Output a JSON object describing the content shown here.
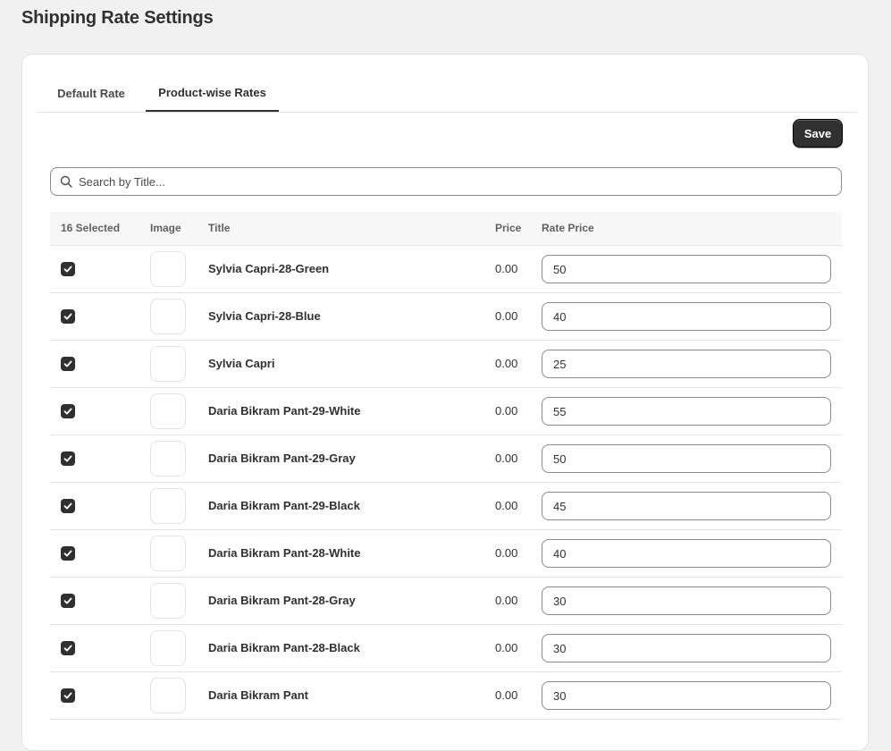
{
  "page": {
    "title": "Shipping Rate Settings"
  },
  "tabs": [
    {
      "label": "Default Rate",
      "active": false
    },
    {
      "label": "Product-wise Rates",
      "active": true
    }
  ],
  "toolbar": {
    "save_label": "Save"
  },
  "search": {
    "placeholder": "Search by Title...",
    "value": ""
  },
  "table": {
    "headers": {
      "selected": "16 Selected",
      "image": "Image",
      "title": "Title",
      "price": "Price",
      "rate_price": "Rate Price"
    },
    "rows": [
      {
        "checked": true,
        "title": "Sylvia Capri-28-Green",
        "price": "0.00",
        "rate": "50"
      },
      {
        "checked": true,
        "title": "Sylvia Capri-28-Blue",
        "price": "0.00",
        "rate": "40"
      },
      {
        "checked": true,
        "title": "Sylvia Capri",
        "price": "0.00",
        "rate": "25"
      },
      {
        "checked": true,
        "title": "Daria Bikram Pant-29-White",
        "price": "0.00",
        "rate": "55"
      },
      {
        "checked": true,
        "title": "Daria Bikram Pant-29-Gray",
        "price": "0.00",
        "rate": "50"
      },
      {
        "checked": true,
        "title": "Daria Bikram Pant-29-Black",
        "price": "0.00",
        "rate": "45"
      },
      {
        "checked": true,
        "title": "Daria Bikram Pant-28-White",
        "price": "0.00",
        "rate": "40"
      },
      {
        "checked": true,
        "title": "Daria Bikram Pant-28-Gray",
        "price": "0.00",
        "rate": "30"
      },
      {
        "checked": true,
        "title": "Daria Bikram Pant-28-Black",
        "price": "0.00",
        "rate": "30"
      },
      {
        "checked": true,
        "title": "Daria Bikram Pant",
        "price": "0.00",
        "rate": "30"
      }
    ]
  },
  "colors": {
    "background": "#f1f1f1",
    "primary_button": "#303030",
    "border": "#e3e3e3"
  },
  "icons": {
    "search": "search-icon",
    "checkbox": "checkmark-icon"
  }
}
